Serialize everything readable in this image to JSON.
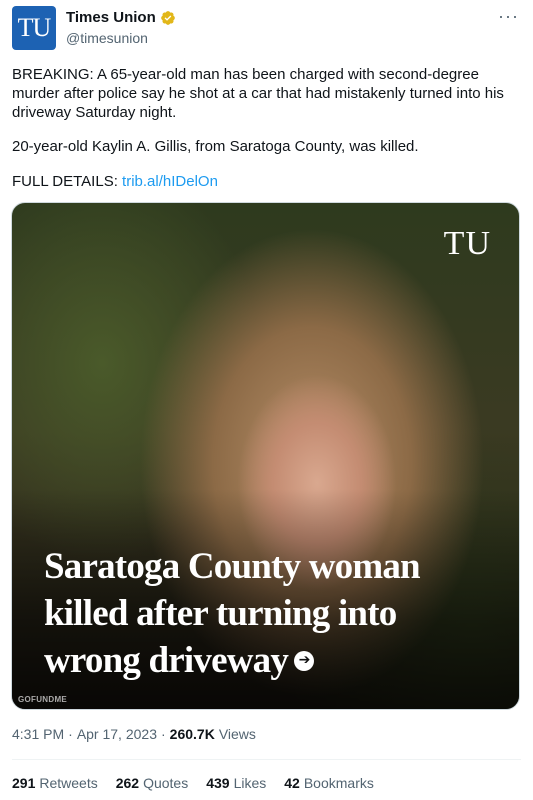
{
  "header": {
    "avatar_text": "TU",
    "display_name": "Times Union",
    "handle": "@timesunion",
    "more_label": "···"
  },
  "tweet": {
    "paragraph1": "BREAKING: A 65-year-old man has been charged with second-degree murder after police say he shot at a car that had mistakenly turned into his driveway Saturday night.",
    "paragraph2": "20-year-old Kaylin A. Gillis, from Saratoga County, was killed.",
    "details_label": "FULL DETAILS:",
    "link_text": "trib.al/hIDelOn"
  },
  "media": {
    "logo_text": "TU",
    "headline": "Saratoga County woman killed after turning into wrong driveway",
    "arrow_glyph": "➔",
    "credit": "GOFUNDME"
  },
  "meta": {
    "time": "4:31 PM",
    "sep1": "·",
    "date": "Apr 17, 2023",
    "sep2": "·",
    "views_count": "260.7K",
    "views_label": "Views"
  },
  "stats": [
    {
      "num": "291",
      "label": "Retweets"
    },
    {
      "num": "262",
      "label": "Quotes"
    },
    {
      "num": "439",
      "label": "Likes"
    },
    {
      "num": "42",
      "label": "Bookmarks"
    }
  ],
  "colors": {
    "accent_link": "#1d9bf0",
    "verified_gold": "#e2b719",
    "avatar_blue": "#1d62b3",
    "muted_text": "#536471"
  },
  "icons": {
    "verified": "verified-badge-icon",
    "more": "more-options-icon",
    "arrow": "arrow-right-icon"
  }
}
